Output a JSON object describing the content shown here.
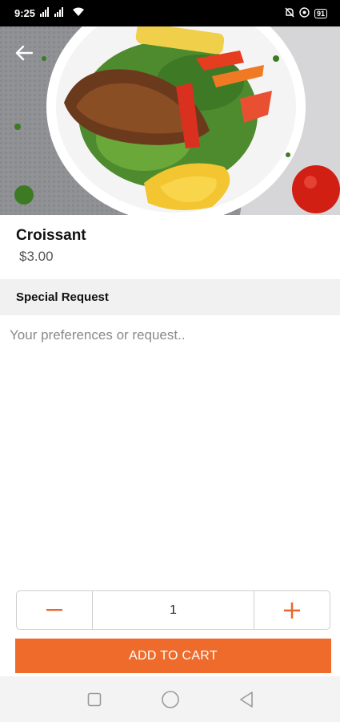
{
  "status_bar": {
    "time": "9:25",
    "signal_text": " .▐l .▐l",
    "battery": "91"
  },
  "hero": {
    "back_icon": "arrow-left-icon",
    "image_subject": "grilled chicken salad plate"
  },
  "product": {
    "title": "Croissant",
    "price": "$3.00"
  },
  "special_request": {
    "header": "Special Request",
    "placeholder": "Your preferences or request..",
    "value": ""
  },
  "quantity": {
    "minus_label": "−",
    "value": "1",
    "plus_label": "+"
  },
  "cart": {
    "add_label": "ADD TO CART"
  },
  "nav": {
    "recent_icon": "square-icon",
    "home_icon": "circle-icon",
    "back_icon": "triangle-back-icon"
  },
  "colors": {
    "accent": "#ee6b2c",
    "section_bg": "#f1f1f1"
  }
}
